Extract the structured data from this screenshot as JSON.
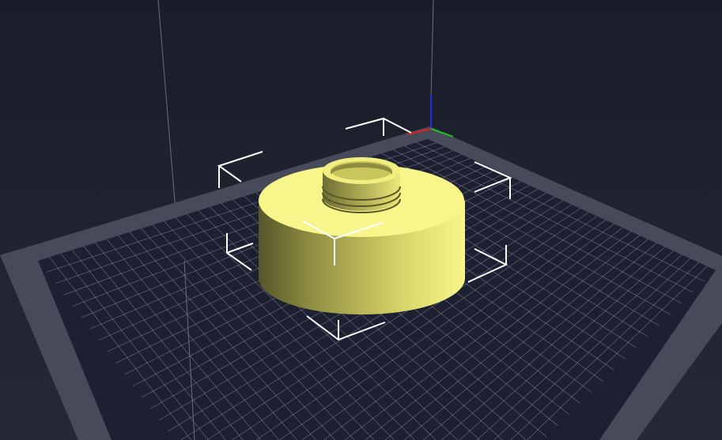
{
  "viewport": {
    "background_top": "#1a1d29",
    "background_bottom": "#252836",
    "bed_border_color": "#474a59",
    "bed_inner_color": "#1d2030",
    "grid_color": "#9a9cab",
    "model_color": "#f6f27c",
    "selection_bracket_color": "#ffffff",
    "axis_colors": {
      "x": "#e02020",
      "y": "#20c020",
      "z": "#2030e0"
    }
  }
}
